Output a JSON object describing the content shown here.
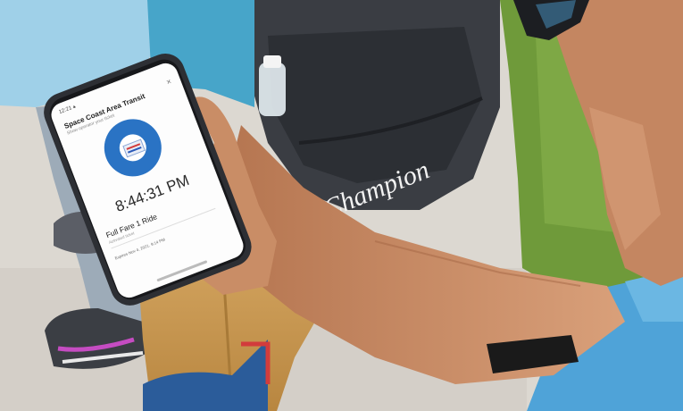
{
  "photo": {
    "description_icons": [
      "phone-icon",
      "backpack-icon",
      "water-bottle-icon"
    ],
    "colors": {
      "sidewalk": "#ddd9d2",
      "grass": "#6f9a3a",
      "phone_frame": "#2d2f34",
      "transit_blue": "#2a73c4",
      "backpack": "#3b3e44",
      "shirt": "#4fa3d8",
      "skin": "#c98d66",
      "pants": "#d3a35e"
    }
  },
  "app": {
    "status_time": "12:21 ▴",
    "title": "Space Coast Area Transit",
    "subtitle": "Show operator your ticket",
    "clock": "8:44:31 PM",
    "ticket_name": "Full Fare 1 Ride",
    "ticket_detail": "Activated ticket",
    "expires": "Expires Nov 4, 2021, 9:14 PM"
  },
  "backpack": {
    "brand_text": "Champion"
  }
}
